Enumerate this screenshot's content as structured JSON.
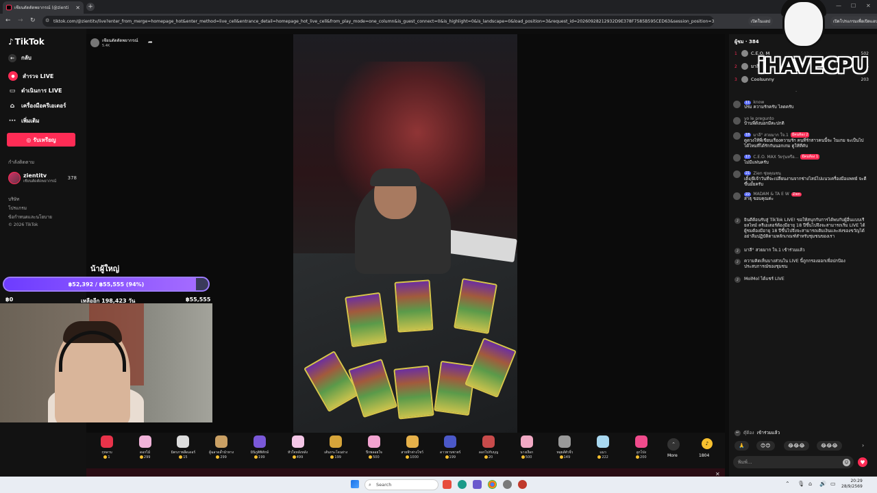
{
  "browser": {
    "tab_title": "เซียนตัดตัดพยากรณ์ (@zienti",
    "url": "tiktok.com/@zientitv/live?enter_from_merge=homepage_hot&enter_method=live_cell&entrance_detail=homepage_hot_live_cell&from_play_mode=one_column&is_guest_connect=0&is_highlight=0&is_landscape=0&load_position=3&request_id=20260928212932D9E378F7585B595CED63&session_position=3",
    "ext_label_1": "เปิดในแอป",
    "ext_label_2": "เปิดโปรแกรมเพื่อเปิดแอป"
  },
  "sidebar": {
    "logo": "TikTok",
    "back_label": "กลับ",
    "items": [
      {
        "label": "สำรวจ LIVE",
        "icon": "live-icon"
      },
      {
        "label": "ดำเนินการ LIVE",
        "icon": "video-icon"
      },
      {
        "label": "เครื่องมือครีเอเตอร์",
        "icon": "home-icon"
      },
      {
        "label": "เพิ่มเติม",
        "icon": "more-icon"
      }
    ],
    "reward_button": "รับเหรียญ",
    "following_title": "กำลังติดตาม",
    "following": {
      "name": "zientitv",
      "subtitle": "เซียนตัดตัดพยากรณ์",
      "count": "378"
    },
    "footer_links": [
      "บริษัท",
      "โปรแกรม",
      "ข้อกำหนดและนโยบาย",
      "© 2026 TikTok"
    ]
  },
  "host": {
    "name": "เซียนตัดตัดพยากรณ์",
    "viewers": "5.4K"
  },
  "donation": {
    "title": "น้าผู้ใหญ่",
    "bar_text": "฿52,392 / ฿55,555 (94%)",
    "progress": 0.94,
    "min_label": "฿0",
    "remaining_label": "เหลืออีก 198,423 วัน",
    "max_label": "฿55,555"
  },
  "gifts": [
    {
      "name": "กุหลาบ",
      "price": "1",
      "color": "#e8334a"
    },
    {
      "name": "ดอกไม้",
      "price": "299",
      "color": "#f0b3d9"
    },
    {
      "name": "มิตรภาพลีดเดอร์",
      "price": "15",
      "color": "#dddddd"
    },
    {
      "name": "ผู้ฉลาดล้ำนำทาง",
      "price": "299",
      "color": "#caa064"
    },
    {
      "name": "มินิภูติพิทักษ์",
      "price": "199",
      "color": "#7a58d8"
    },
    {
      "name": "หัวใจหลังหลัง",
      "price": "499",
      "color": "#f4c6e6"
    },
    {
      "name": "เต้นกระโจนย่าง",
      "price": "199",
      "color": "#d7a53a"
    },
    {
      "name": "ปีกพลอยใจ",
      "price": "500",
      "color": "#f2a3d0"
    },
    {
      "name": "สายฟ้าต่างโชว์",
      "price": "1000",
      "color": "#e6b14a"
    },
    {
      "name": "ดาวทาบซาตร์",
      "price": "199",
      "color": "#4b58c8"
    },
    {
      "name": "ลอกไปกับบุญ",
      "price": "20",
      "color": "#c84b4b"
    },
    {
      "name": "นางเงือก",
      "price": "500",
      "color": "#f1a9c4"
    },
    {
      "name": "หลุยส์ตัวจิ๋ว",
      "price": "149",
      "color": "#999999"
    },
    {
      "name": "แมว",
      "price": "222",
      "color": "#a8d8f0"
    },
    {
      "name": "ลูกโป่ง",
      "price": "200",
      "color": "#f04b8c"
    }
  ],
  "gift_more_label": "More",
  "coins": "1804",
  "chat": {
    "viewers_title": "ผู้ชม · 384",
    "ranking": [
      {
        "rank": "1",
        "name": "C.E.O. M",
        "score": "502"
      },
      {
        "rank": "2",
        "name": "มาลี",
        "score": "315"
      },
      {
        "rank": "3",
        "name": "Coolsunny",
        "score": "203"
      }
    ],
    "messages": [
      {
        "level": "11",
        "name": "know",
        "badge": "",
        "text": "ปรม ความรักครับ ไลดครับ"
      },
      {
        "level": "",
        "name": "yo le pregunto",
        "badge": "",
        "text": "บ้านพี่ดังนอกมีคะปกติ"
      },
      {
        "level": "18",
        "name": "มาลี° สวยมาก ใจ.1",
        "badge": "มีคนห้อง 2",
        "text": "ดูดวงให้พี่เขียนเรื่องความรัก คนที่รักสาวคนนี้จะ ในเกม จะเป็นไปได้ไหมที่ได้รักกันนอกเกม ดูให้ที่คับ"
      },
      {
        "level": "17",
        "name": "C.E.O. MAX วัยรุ่นหรือ...",
        "badge": "มีคนห้อง 1",
        "text": "ไม่มีแฟนครับ"
      },
      {
        "level": "21",
        "name": "Zien  ซุ่ยคุณซน",
        "badge": "",
        "text": "เดิ้ง/ผีเจ้าวันที่จะเปลี่ยนงานจากช่างไลน์ไปแนวเครื่องมือแพทย์ จะดีขึ้นมั้ยครับ"
      },
      {
        "level": "22",
        "name": "MADAM & TA E W",
        "badge": "Zien",
        "text": "สาธุ ขอบคุณค่ะ"
      }
    ],
    "system_messages": [
      "ยินดีต้อนรับสู่ TikTok LIVE! ขอให้สนุกกับการได้พบกับผู้อื่นแบบเรียลไทม์ ครีเอเตอร์ต้องมีอายุ 18 ปีขึ้นไปจึงจะสามารถเริ่ม LIVE ได้ ผู้ชมต้องมีอายุ 18 ปีขึ้นไปจึงจะสามารถเติมเงินและส่งของขวัญได้ อย่าลืมปฏิบัติตามหลักเกณฑ์สำหรับชุมชนของเรา",
      "มาลี° สวยมาก ใจ.1  เข้าร่วมแล้ว",
      "ความคิดเห็นบางส่วนใน LIVE นี้ถูกกรองออกเพื่อปกป้องประสบการณ์ของชุมชน",
      "MolMol  ได้แชร์ LIVE"
    ],
    "join_notice": {
      "name": "ดุ๊ต้อง",
      "text": "เข้าร่วมแล้ว"
    },
    "quick_reactions": [
      "🙏",
      "😊😊",
      "😂😂😂",
      "😂😂😂"
    ],
    "input_placeholder": "พิมพ์..."
  },
  "watermark": "iHAVECPU",
  "taskbar": {
    "search_label": "Search",
    "time": "20:29",
    "date": "28/9/2569"
  }
}
